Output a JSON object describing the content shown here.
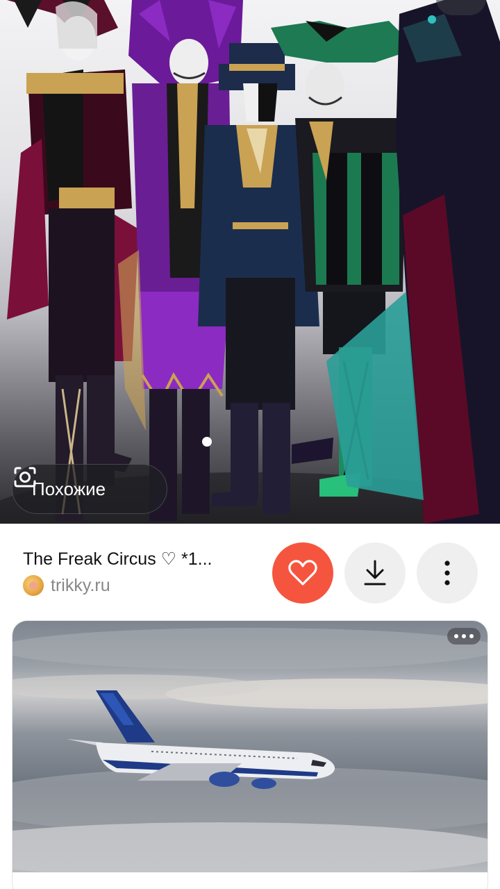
{
  "hero": {
    "similar_label": "Похожие"
  },
  "result": {
    "title": "The Freak Circus ♡ *1...",
    "source": "trikky.ru",
    "like_icon": "heart-icon",
    "download_icon": "download-icon",
    "more_icon": "more-vertical-icon"
  },
  "colors": {
    "like_accent": "#f5553f",
    "button_bg": "#efefef"
  }
}
